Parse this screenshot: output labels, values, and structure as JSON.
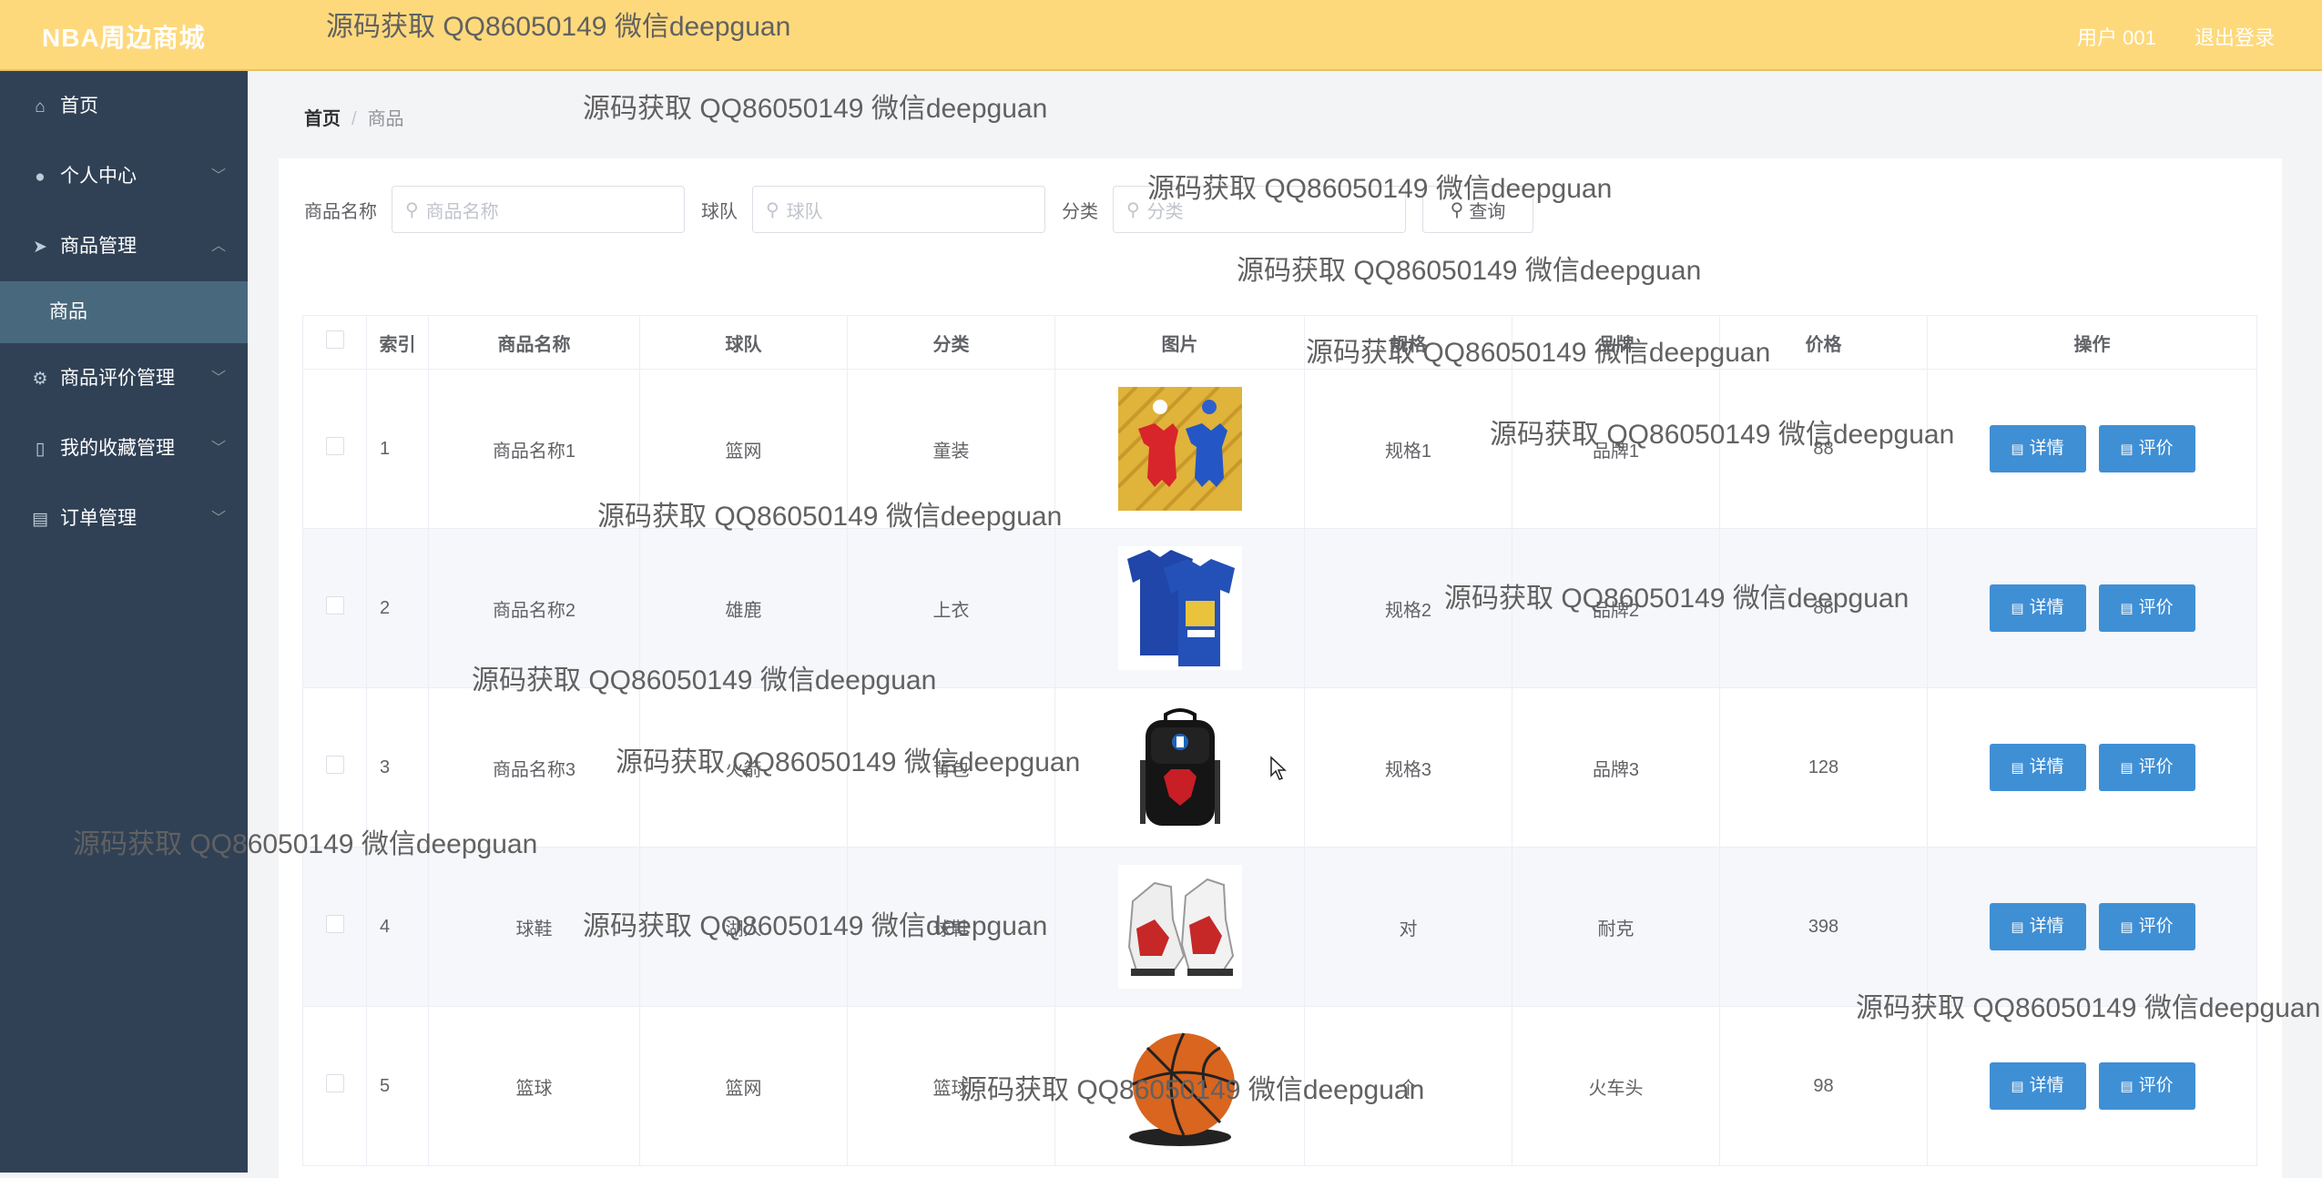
{
  "header": {
    "title": "NBA周边商城",
    "user": "用户 001",
    "logout": "退出登录"
  },
  "sidebar": {
    "items": [
      {
        "label": "首页",
        "icon": "home-icon"
      },
      {
        "label": "个人中心",
        "icon": "user-icon"
      },
      {
        "label": "商品管理",
        "icon": "send-icon"
      },
      {
        "label": "商品评价管理",
        "icon": "gear-icon"
      },
      {
        "label": "我的收藏管理",
        "icon": "phone-icon"
      },
      {
        "label": "订单管理",
        "icon": "briefcase-icon"
      }
    ],
    "sub_item": "商品"
  },
  "breadcrumb": {
    "home": "首页",
    "sep": "/",
    "current": "商品"
  },
  "search": {
    "name_label": "商品名称",
    "name_placeholder": "商品名称",
    "team_label": "球队",
    "team_placeholder": "球队",
    "category_label": "分类",
    "category_placeholder": "分类",
    "query_button": "查询"
  },
  "table": {
    "headers": [
      "索引",
      "商品名称",
      "球队",
      "分类",
      "图片",
      "规格",
      "品牌",
      "价格",
      "操作"
    ],
    "rows": [
      {
        "index": "1",
        "name": "商品名称1",
        "team": "篮网",
        "category": "童装",
        "spec": "规格1",
        "brand": "品牌1",
        "price": "88"
      },
      {
        "index": "2",
        "name": "商品名称2",
        "team": "雄鹿",
        "category": "上衣",
        "spec": "规格2",
        "brand": "品牌2",
        "price": "88"
      },
      {
        "index": "3",
        "name": "商品名称3",
        "team": "火箭",
        "category": "背包",
        "spec": "规格3",
        "brand": "品牌3",
        "price": "128"
      },
      {
        "index": "4",
        "name": "球鞋",
        "team": "湖人",
        "category": "球鞋",
        "spec": "对",
        "brand": "耐克",
        "price": "398"
      },
      {
        "index": "5",
        "name": "篮球",
        "team": "篮网",
        "category": "篮球",
        "spec": "个",
        "brand": "火车头",
        "price": "98"
      }
    ],
    "detail_button": "详情",
    "review_button": "评价"
  },
  "watermark": "源码获取 QQ86050149 微信deepguan"
}
